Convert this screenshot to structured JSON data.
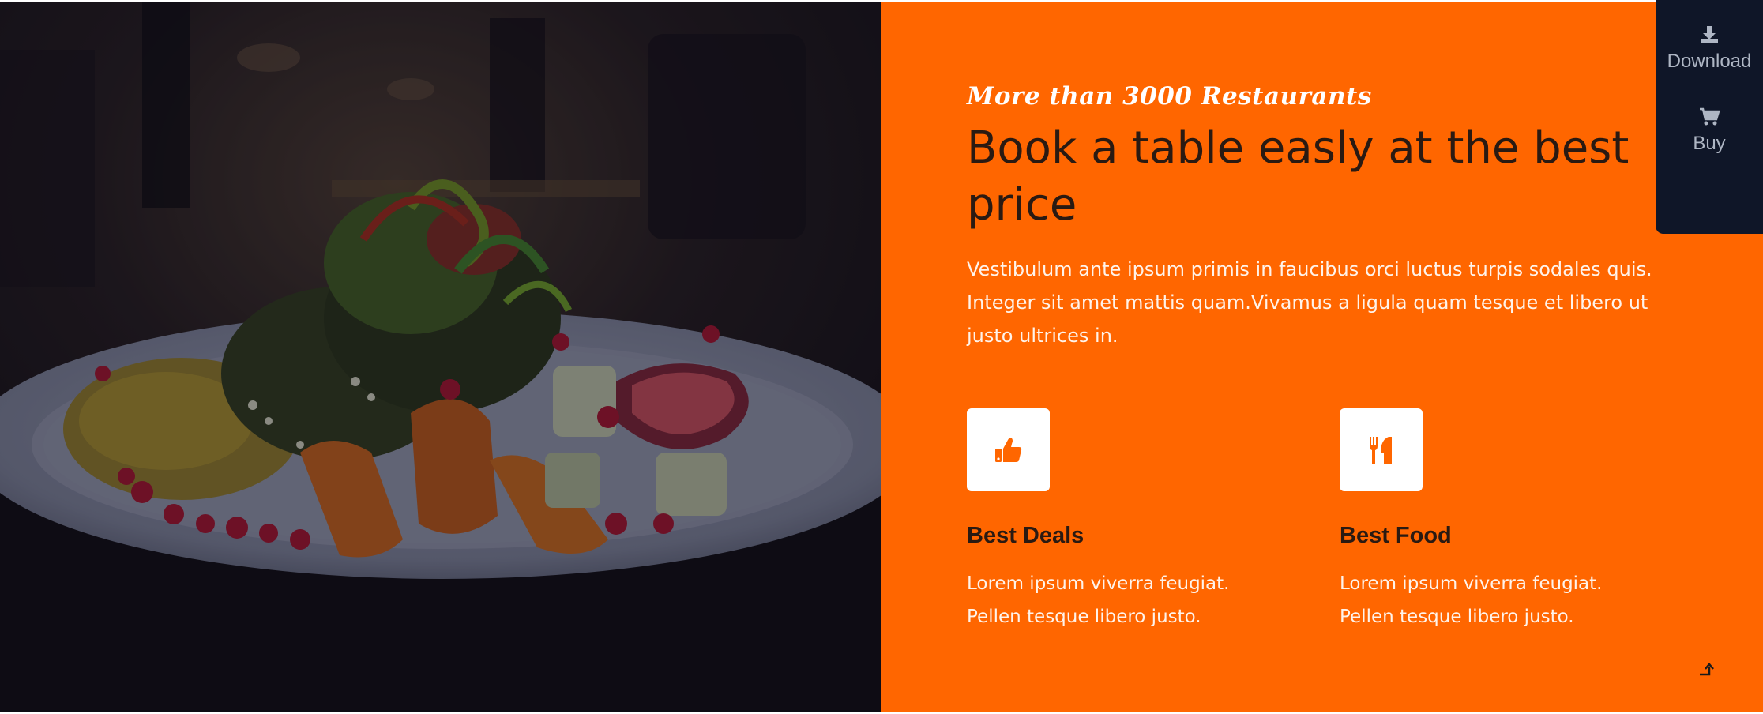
{
  "hero": {
    "kicker": "More than 3000 Restaurants",
    "headline": "Book a table easly at the best price",
    "description": "Vestibulum ante ipsum primis in faucibus orci luctus turpis sodales quis. Integer sit amet mattis quam.Vivamus a ligula quam tesque et libero ut justo ultrices in."
  },
  "features": [
    {
      "icon": "thumbs-up-icon",
      "title": "Best Deals",
      "text": "Lorem ipsum viverra feugiat. Pellen tesque libero justo."
    },
    {
      "icon": "utensils-icon",
      "title": "Best Food",
      "text": "Lorem ipsum viverra feugiat. Pellen tesque libero justo."
    }
  ],
  "side_panel": {
    "download_label": "Download",
    "download_icon": "download-icon",
    "buy_label": "Buy",
    "buy_icon": "cart-icon"
  },
  "colors": {
    "accent": "#ff6600",
    "heading": "#2a1a12",
    "panel": "#0f1628",
    "panel_text": "#aeb6c4"
  }
}
